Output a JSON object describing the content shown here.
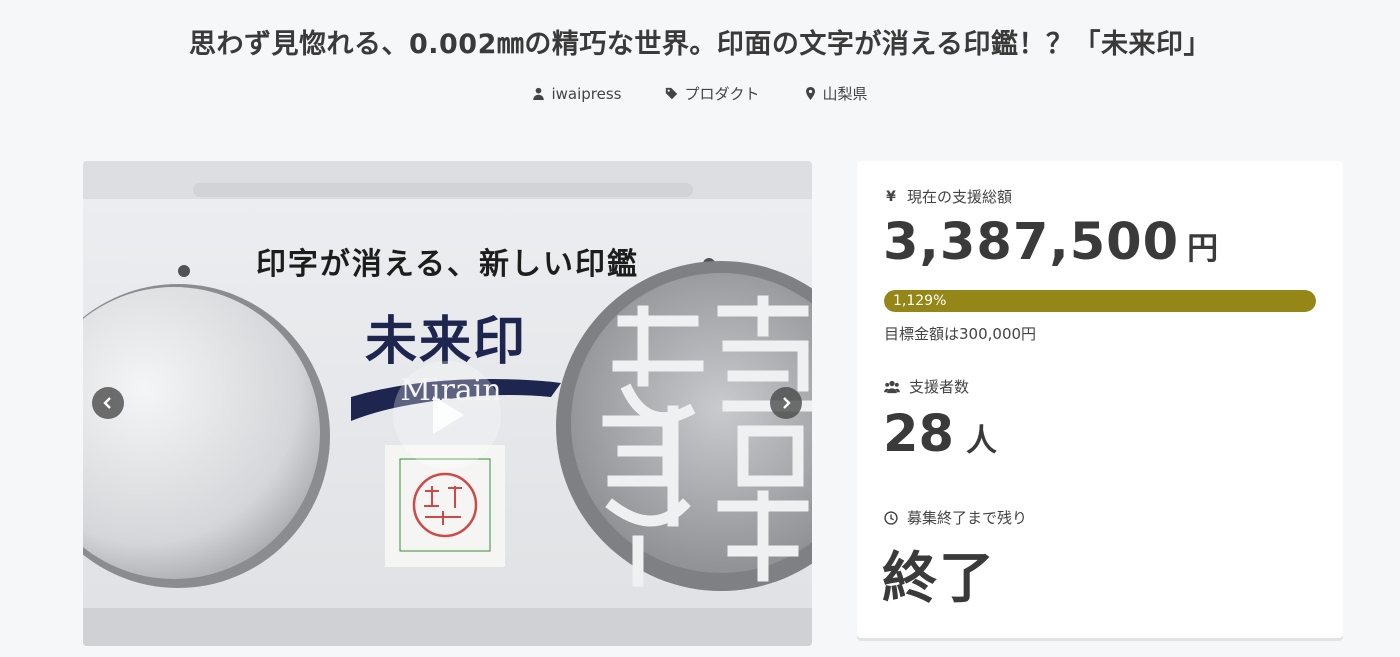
{
  "header": {
    "title": "思わず見惚れる、0.002㎜の精巧な世界。印面の文字が消える印鑑！？「未来印」",
    "author": "iwaipress",
    "category": "プロダクト",
    "location": "山梨県"
  },
  "media": {
    "catch_copy": "印字が消える、新しい印鑑",
    "logo_text": "未来印",
    "logo_sub": "Mirain"
  },
  "stats": {
    "total_label": "現在の支援総額",
    "total_amount": "3,387,500",
    "currency_unit": "円",
    "progress_text": "1,129%",
    "progress_fraction": 1.0,
    "goal_text": "目標金額は300,000円",
    "backers_label": "支援者数",
    "backers_count": "28",
    "backers_unit": "人",
    "remaining_label": "募集終了まで残り",
    "remaining_value": "終了"
  },
  "icons": {
    "author": "user-icon",
    "category": "tag-icon",
    "location": "map-pin-icon",
    "total": "yen-icon",
    "backers": "users-icon",
    "remaining": "clock-icon"
  },
  "colors": {
    "progress": "#958717",
    "background": "#f6f7f9"
  }
}
